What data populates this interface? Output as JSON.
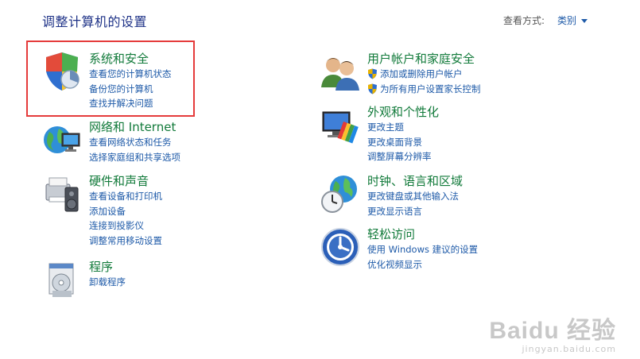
{
  "header": {
    "title": "调整计算机的设置",
    "view_by_label": "查看方式:",
    "view_by_value": "类别"
  },
  "left": [
    {
      "title": "系统和安全",
      "icon": "system-security-icon",
      "links": [
        "查看您的计算机状态",
        "备份您的计算机",
        "查找并解决问题"
      ]
    },
    {
      "title": "网络和 Internet",
      "icon": "network-internet-icon",
      "links": [
        "查看网络状态和任务",
        "选择家庭组和共享选项"
      ]
    },
    {
      "title": "硬件和声音",
      "icon": "hardware-sound-icon",
      "links": [
        "查看设备和打印机",
        "添加设备",
        "连接到投影仪",
        "调整常用移动设置"
      ]
    },
    {
      "title": "程序",
      "icon": "programs-icon",
      "links": [
        "卸载程序"
      ]
    }
  ],
  "right": [
    {
      "title": "用户帐户和家庭安全",
      "icon": "user-accounts-icon",
      "links": [
        "添加或删除用户帐户",
        "为所有用户设置家长控制"
      ]
    },
    {
      "title": "外观和个性化",
      "icon": "appearance-icon",
      "links": [
        "更改主题",
        "更改桌面背景",
        "调整屏幕分辨率"
      ]
    },
    {
      "title": "时钟、语言和区域",
      "icon": "clock-language-icon",
      "links": [
        "更改键盘或其他输入法",
        "更改显示语言"
      ]
    },
    {
      "title": "轻松访问",
      "icon": "ease-of-access-icon",
      "links": [
        "使用 Windows 建议的设置",
        "优化视频显示"
      ]
    }
  ],
  "watermark": {
    "main": "Baidu 经验",
    "sub": "jingyan.baidu.com"
  }
}
